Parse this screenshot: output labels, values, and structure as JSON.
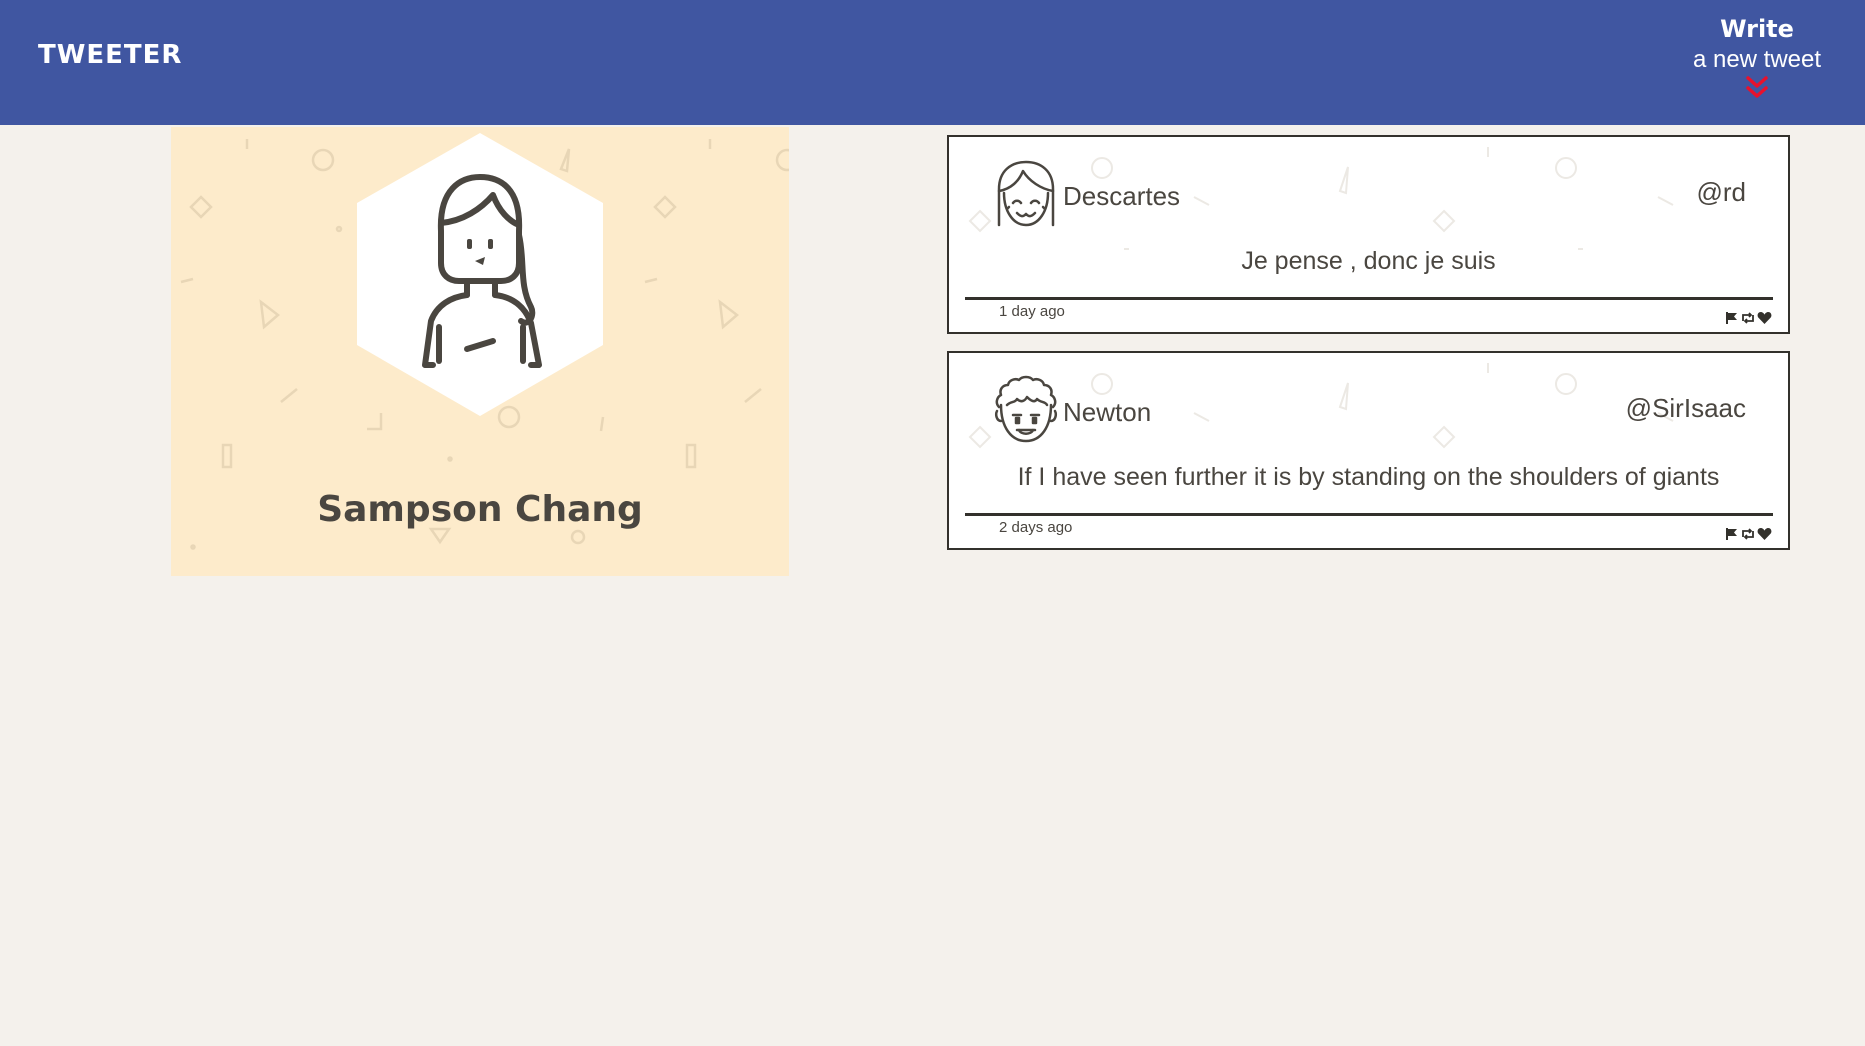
{
  "nav": {
    "brand": "TWEETER",
    "compose_line1": "Write",
    "compose_line2": "a new tweet",
    "compose_icon": "double-chevron-down-icon",
    "background_color": "#4056a1",
    "accent_color": "#e8112d"
  },
  "profile": {
    "name": "Sampson Chang",
    "avatar_icon": "woman-avatar-icon",
    "background_color": "#fdebcb"
  },
  "tweets": [
    {
      "avatar_icon": "smiling-face-avatar-icon",
      "name": "Descartes",
      "handle": "@rd",
      "text": "Je pense , donc je suis",
      "time": "1 day ago",
      "actions": [
        "flag-icon",
        "retweet-icon",
        "heart-icon"
      ]
    },
    {
      "avatar_icon": "curly-hair-avatar-icon",
      "name": "Newton",
      "handle": "@SirIsaac",
      "text": "If I have seen further it is by standing on the shoulders of giants",
      "time": "2 days ago",
      "actions": [
        "flag-icon",
        "retweet-icon",
        "heart-icon"
      ]
    }
  ],
  "page": {
    "background_color": "#f4f1ec"
  }
}
